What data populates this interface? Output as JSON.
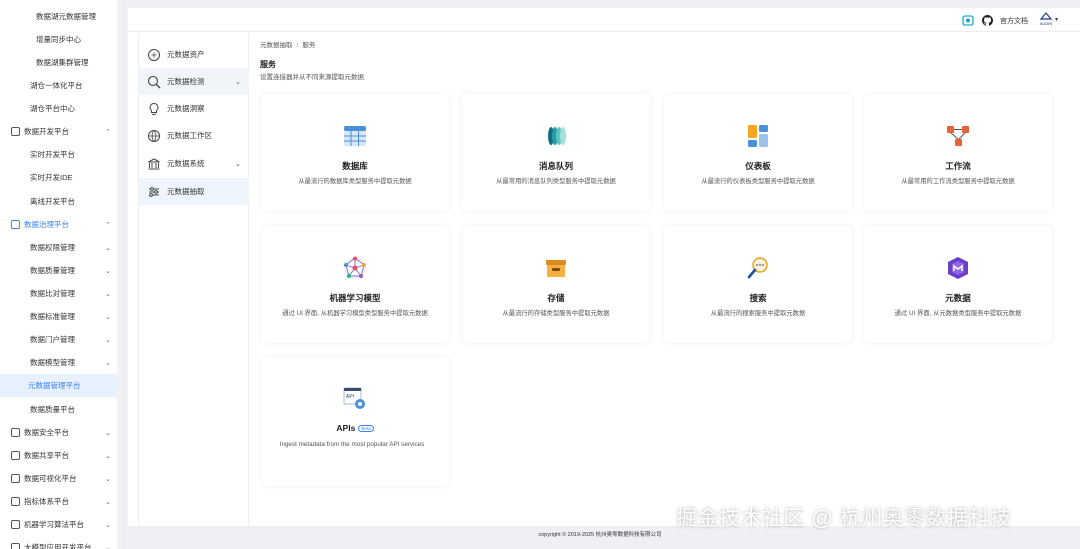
{
  "nav": {
    "items": [
      {
        "label": "数据湖元数据管理",
        "type": "sub2"
      },
      {
        "label": "增量同步中心",
        "type": "sub2"
      },
      {
        "label": "数据湖集群管理",
        "type": "sub2"
      },
      {
        "label": "湖仓一体化平台",
        "type": "sub"
      },
      {
        "label": "湖仓平台中心",
        "type": "sub"
      },
      {
        "label": "数据开发平台",
        "type": "section",
        "chev": "^"
      },
      {
        "label": "实时开发平台",
        "type": "sub"
      },
      {
        "label": "实时开发IDE",
        "type": "sub"
      },
      {
        "label": "离线开发平台",
        "type": "sub"
      },
      {
        "label": "数据治理平台",
        "type": "section-active",
        "chev": "^"
      },
      {
        "label": "数据权限管理",
        "type": "sub",
        "chev": "v"
      },
      {
        "label": "数据质量管理",
        "type": "sub",
        "chev": "v"
      },
      {
        "label": "数据比对管理",
        "type": "sub",
        "chev": "v"
      },
      {
        "label": "数据标准管理",
        "type": "sub",
        "chev": "v"
      },
      {
        "label": "数据门户管理",
        "type": "sub",
        "chev": "v"
      },
      {
        "label": "数据模型管理",
        "type": "sub",
        "chev": "v"
      },
      {
        "label": "元数据管理平台",
        "type": "selected"
      },
      {
        "label": "数据质量平台",
        "type": "sub"
      },
      {
        "label": "数据安全平台",
        "type": "section",
        "chev": "v"
      },
      {
        "label": "数据共享平台",
        "type": "section",
        "chev": "v"
      },
      {
        "label": "数据可视化平台",
        "type": "section",
        "chev": "v"
      },
      {
        "label": "指标体系平台",
        "type": "section",
        "chev": "v"
      },
      {
        "label": "机器学习算法平台",
        "type": "section",
        "chev": "v"
      },
      {
        "label": "大模型应用开发平台",
        "type": "section",
        "chev": "v"
      }
    ]
  },
  "topbar": {
    "docs_label": "官方文档",
    "user_label": "AUDIN",
    "user_chev": "▾"
  },
  "submenu": {
    "items": [
      {
        "label": "元数据资产",
        "chev": ""
      },
      {
        "label": "元数据检测",
        "chev": "⌄"
      },
      {
        "label": "元数据洞察",
        "chev": ""
      },
      {
        "label": "元数据工作区",
        "chev": ""
      },
      {
        "label": "元数据系统",
        "chev": "⌄"
      },
      {
        "label": "元数据抽取",
        "chev": ""
      }
    ]
  },
  "breadcrumb": {
    "root": "元数据抽取",
    "sep": "/",
    "current": "服务"
  },
  "page": {
    "title": "服务",
    "subtitle": "设置连接器并从不同来源提取元数据"
  },
  "cards": [
    {
      "title": "数据库",
      "desc": "从最流行的数据库类型服务中提取元数据",
      "icon": "database-icon"
    },
    {
      "title": "消息队列",
      "desc": "从最常用的消息队列类型服务中提取元数据",
      "icon": "message-queue-icon"
    },
    {
      "title": "仪表板",
      "desc": "从最流行的仪表板类型服务中提取元数据",
      "icon": "dashboard-icon"
    },
    {
      "title": "工作流",
      "desc": "从最常用的工作流类型服务中提取元数据",
      "icon": "workflow-icon"
    },
    {
      "title": "机器学习模型",
      "desc": "通过 UI 界面, 从机器学习模型类型服务中提取元数据",
      "icon": "ml-model-icon"
    },
    {
      "title": "存储",
      "desc": "从最流行的存储类型服务中提取元数据",
      "icon": "storage-icon"
    },
    {
      "title": "搜索",
      "desc": "从最流行的搜索服务中提取元数据",
      "icon": "search-icon"
    },
    {
      "title": "元数据",
      "desc": "通过 UI 界面, 从元数据类型服务中提取元数据",
      "icon": "metadata-icon"
    },
    {
      "title": "APIs",
      "badge": "Beta",
      "desc": "Ingest metadata from the most popular API services",
      "icon": "api-icon"
    }
  ],
  "footer": "copyright © 2019-2025 杭州奥零数据科技有限公司",
  "watermark": "掘金技术社区 @ 杭州奥零数据科技",
  "colors": {
    "accent": "#3b82f6",
    "background": "#eef0f3"
  }
}
